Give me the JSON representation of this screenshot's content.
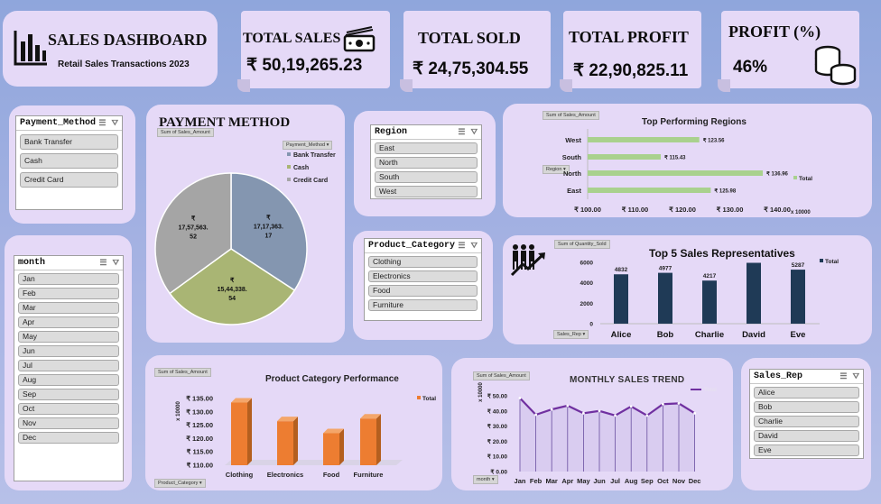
{
  "header": {
    "title": "SALES DASHBOARD",
    "subtitle": "Retail Sales Transactions 2023"
  },
  "kpis": {
    "total_sales": {
      "label": "TOTAL SALES",
      "value": "₹ 50,19,265.23"
    },
    "total_sold": {
      "label": "TOTAL SOLD",
      "value": "₹ 24,75,304.55"
    },
    "total_profit": {
      "label": "TOTAL PROFIT",
      "value": "₹ 22,90,825.11"
    },
    "profit_pct": {
      "label": "PROFIT (%)",
      "value": "46%"
    }
  },
  "slicers": {
    "payment_method": {
      "title": "Payment_Method",
      "items": [
        "Bank Transfer",
        "Cash",
        "Credit Card"
      ]
    },
    "month": {
      "title": "month",
      "items": [
        "Jan",
        "Feb",
        "Mar",
        "Apr",
        "May",
        "Jun",
        "Jul",
        "Aug",
        "Sep",
        "Oct",
        "Nov",
        "Dec"
      ]
    },
    "region": {
      "title": "Region",
      "items": [
        "East",
        "North",
        "South",
        "West"
      ]
    },
    "product_category": {
      "title": "Product_Category",
      "items": [
        "Clothing",
        "Electronics",
        "Food",
        "Furniture"
      ]
    },
    "sales_rep": {
      "title": "Sales_Rep",
      "items": [
        "Alice",
        "Bob",
        "Charlie",
        "David",
        "Eve"
      ]
    }
  },
  "icons": {
    "dashboard": "bar-chart-icon",
    "sales": "banknote-icon",
    "profit": "coin-stack-icon",
    "reps": "people-growth-icon",
    "multi_select": "multi-select-icon",
    "clear_filter": "clear-filter-icon"
  },
  "colors": {
    "panel": "#e5d9f7",
    "bank_transfer": "#8496b0",
    "cash": "#a9b574",
    "credit_card": "#a5a5a5",
    "region_bar": "#a9d18e",
    "rep_bar": "#1f3a56",
    "category_bar": "#ed7d31",
    "trend_line": "#7030a0"
  },
  "charts": {
    "payment": {
      "title": "PAYMENT METHOD",
      "field": "Sum of Sales_Amount",
      "legend_field": "Payment_Method",
      "labels": {
        "bank_transfer": "₹ 17,17,363. 17",
        "cash": "₹ 15,44,338. 54",
        "credit_card": "₹ 17,57,563. 52"
      }
    },
    "regions": {
      "title": "Top Performing Regions",
      "field": "Sum of Sales_Amount",
      "axis_field": "Region",
      "legend": "Total",
      "unit_label": "x 10000",
      "data_labels": [
        "₹ 123.56",
        "₹ 115.43",
        "₹ 136.96",
        "₹ 125.98"
      ]
    },
    "reps": {
      "title": "Top 5 Sales Representatives",
      "field": "Sum of Quantity_Sold",
      "axis_field": "Sales_Rep",
      "legend": "Total"
    },
    "category": {
      "title": "Product Category Performance",
      "field": "Sum of Sales_Amount",
      "axis_field": "Product_Category",
      "legend": "Total",
      "unit_label": "x 10000"
    },
    "trend": {
      "title": "MONTHLY SALES TREND",
      "field": "Sum of Sales_Amount",
      "axis_field": "month",
      "legend": "Total",
      "unit_label": "x 10000"
    }
  },
  "chart_data": [
    {
      "type": "pie",
      "title": "PAYMENT METHOD",
      "categories": [
        "Bank Transfer",
        "Cash",
        "Credit Card"
      ],
      "values": [
        1717363.17,
        1544338.54,
        1757563.52
      ]
    },
    {
      "type": "bar",
      "title": "Top Performing Regions",
      "orientation": "horizontal",
      "categories": [
        "West",
        "South",
        "North",
        "East"
      ],
      "values": [
        123.56,
        115.43,
        136.96,
        125.98
      ],
      "xlim": [
        100,
        140
      ],
      "ticks": [
        "₹ 100.00",
        "₹ 110.00",
        "₹ 120.00",
        "₹ 130.00",
        "₹ 140.00"
      ]
    },
    {
      "type": "bar",
      "title": "Top 5 Sales Representatives",
      "categories": [
        "Alice",
        "Bob",
        "Charlie",
        "David",
        "Eve"
      ],
      "values": [
        4832,
        4977,
        4217,
        5956,
        5287
      ],
      "value_labels": [
        "4832",
        "4977",
        "4217",
        "",
        "5287"
      ],
      "ylim": [
        0,
        6000
      ],
      "ticks": [
        "0",
        "2000",
        "4000",
        "6000"
      ]
    },
    {
      "type": "bar",
      "title": "Product Category Performance",
      "categories": [
        "Clothing",
        "Electronics",
        "Food",
        "Furniture"
      ],
      "values": [
        133.5,
        126.5,
        122,
        127.5
      ],
      "ylim": [
        110,
        135
      ],
      "ticks": [
        "₹ 110.00",
        "₹ 115.00",
        "₹ 120.00",
        "₹ 125.00",
        "₹ 130.00",
        "₹ 135.00"
      ]
    },
    {
      "type": "line",
      "title": "MONTHLY SALES TREND",
      "categories": [
        "Jan",
        "Feb",
        "Mar",
        "Apr",
        "May",
        "Jun",
        "Jul",
        "Aug",
        "Sep",
        "Oct",
        "Nov",
        "Dec"
      ],
      "values": [
        48.5,
        37.5,
        41,
        43.5,
        38.5,
        40,
        37,
        43,
        37,
        44.5,
        45,
        38.5
      ],
      "ylim": [
        0,
        50
      ],
      "ticks": [
        "₹ 0.00",
        "₹ 10.00",
        "₹ 20.00",
        "₹ 30.00",
        "₹ 40.00",
        "₹ 50.00"
      ]
    }
  ]
}
